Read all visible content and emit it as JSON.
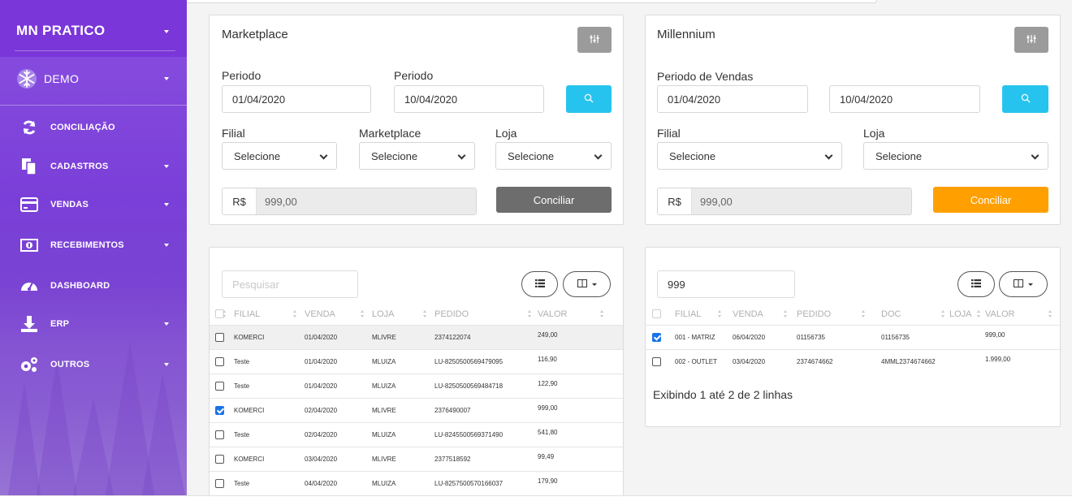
{
  "sidebar": {
    "brand": "MN  PRATICO",
    "account": "DEMO",
    "items": [
      {
        "label": "CONCILIAÇÃO",
        "icon": "sync-icon",
        "has_caret": false
      },
      {
        "label": "CADASTROS",
        "icon": "copy-icon",
        "has_caret": true
      },
      {
        "label": "VENDAS",
        "icon": "credit-card-icon",
        "has_caret": true
      },
      {
        "label": "RECEBIMENTOS",
        "icon": "money-bill-icon",
        "has_caret": true
      },
      {
        "label": "DASHBOARD",
        "icon": "tachometer-icon",
        "has_caret": false
      },
      {
        "label": "ERP",
        "icon": "download-icon",
        "has_caret": true
      },
      {
        "label": "OUTROS",
        "icon": "cogs-icon",
        "has_caret": true
      }
    ]
  },
  "marketplace": {
    "title": "Marketplace",
    "period_label_1": "Periodo",
    "period_label_2": "Periodo",
    "date_from": "01/04/2020",
    "date_to": "10/04/2020",
    "filial_label": "Filial",
    "marketplace_label": "Marketplace",
    "loja_label": "Loja",
    "filial_value": "Selecione",
    "marketplace_value": "Selecione",
    "loja_value": "Selecione",
    "currency": "R$",
    "amount": "999,00",
    "conciliar": "Conciliar"
  },
  "millennium": {
    "title": "Millennium",
    "period_label": "Periodo de Vendas",
    "date_from": "01/04/2020",
    "date_to": "10/04/2020",
    "filial_label": "Filial",
    "loja_label": "Loja",
    "filial_value": "Selecione",
    "loja_value": "Selecione",
    "currency": "R$",
    "amount": "999,00",
    "conciliar": "Conciliar"
  },
  "left_table": {
    "search_placeholder": "Pesquisar",
    "columns": [
      "FILIAL",
      "VENDA",
      "LOJA",
      "PEDIDO",
      "VALOR"
    ],
    "rows": [
      {
        "checked": false,
        "highlight": true,
        "filial": "KOMERCI",
        "venda": "01/04/2020",
        "loja": "MLIVRE",
        "pedido": "2374122074",
        "valor": "249,00"
      },
      {
        "checked": false,
        "highlight": false,
        "filial": "Teste",
        "venda": "01/04/2020",
        "loja": "MLUIZA",
        "pedido": "LU-8250500569479095",
        "valor": "116,90"
      },
      {
        "checked": false,
        "highlight": false,
        "filial": "Teste",
        "venda": "01/04/2020",
        "loja": "MLUIZA",
        "pedido": "LU-8250500569484718",
        "valor": "122,90"
      },
      {
        "checked": true,
        "highlight": false,
        "filial": "KOMERCI",
        "venda": "02/04/2020",
        "loja": "MLIVRE",
        "pedido": "2376490007",
        "valor": "999,00"
      },
      {
        "checked": false,
        "highlight": false,
        "filial": "Teste",
        "venda": "02/04/2020",
        "loja": "MLUIZA",
        "pedido": "LU-8245500569371490",
        "valor": "541,80"
      },
      {
        "checked": false,
        "highlight": false,
        "filial": "KOMERCI",
        "venda": "03/04/2020",
        "loja": "MLIVRE",
        "pedido": "2377518592",
        "valor": "99,49"
      },
      {
        "checked": false,
        "highlight": false,
        "filial": "Teste",
        "venda": "04/04/2020",
        "loja": "MLUIZA",
        "pedido": "LU-8257500570166037",
        "valor": "179,90"
      }
    ]
  },
  "right_table": {
    "search_value": "999",
    "columns": [
      "FILIAL",
      "VENDA",
      "PEDIDO",
      "DOC",
      "LOJA",
      "VALOR"
    ],
    "rows": [
      {
        "checked": true,
        "filial": "001 - MATRIZ",
        "venda": "06/04/2020",
        "pedido": "01156735",
        "doc": "01156735",
        "loja": "",
        "valor": "999,00"
      },
      {
        "checked": false,
        "filial": "002 - OUTLET",
        "venda": "03/04/2020",
        "pedido": "2374674662",
        "doc": "4MML2374674662",
        "loja": "",
        "valor": "1.999,00"
      }
    ],
    "footer": "Exibindo 1 até 2 de 2 linhas"
  },
  "colors": {
    "sidebar": "#7a3fd8",
    "search_button": "#27c3ef",
    "conciliar_gray": "#6d6d6d",
    "conciliar_orange": "#ffa000",
    "checkbox_checked": "#1a73e8"
  }
}
